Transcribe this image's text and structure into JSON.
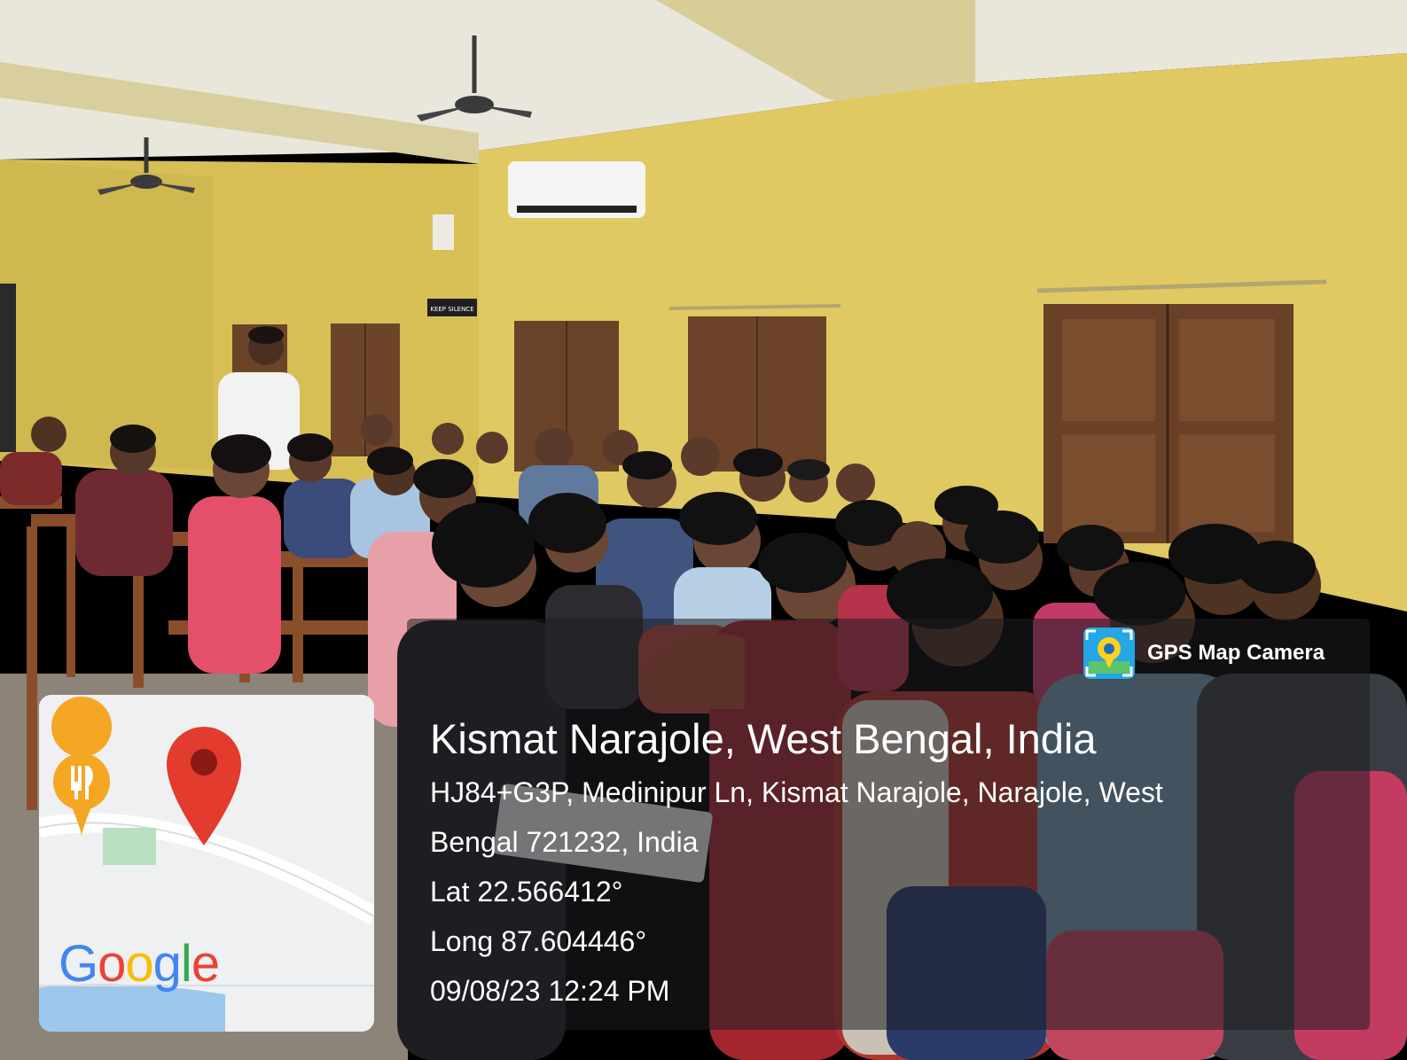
{
  "scene": {
    "wall_color": "#ddc861",
    "ceiling_color": "#e8e4d8",
    "door_color": "#6b4328",
    "floor_color": "#8a8176",
    "wall_sign": "KEEP SILENCE"
  },
  "map_card": {
    "background": "#eef0f1",
    "pin_color": "#e33b2e",
    "restaurant_pin_color": "#f5a623",
    "park_color": "#b8e0c0",
    "water_color": "#9cc7ea",
    "logo_letters": [
      {
        "char": "G",
        "color": "#4285f4"
      },
      {
        "char": "o",
        "color": "#ea4335"
      },
      {
        "char": "o",
        "color": "#fbbc05"
      },
      {
        "char": "g",
        "color": "#4285f4"
      },
      {
        "char": "l",
        "color": "#34a853"
      },
      {
        "char": "e",
        "color": "#ea4335"
      }
    ]
  },
  "gps_badge": {
    "app_name": "GPS Map Camera",
    "icon": "gps-map-camera-icon"
  },
  "location": {
    "place_title": "Kismat Narajole, West Bengal, India",
    "address_line_1": "HJ84+G3P, Medinipur Ln, Kismat Narajole, Narajole, West",
    "address_line_2": "Bengal 721232, India",
    "latitude": "Lat 22.566412°",
    "longitude": "Long 87.604446°",
    "timestamp": "09/08/23 12:24 PM"
  }
}
